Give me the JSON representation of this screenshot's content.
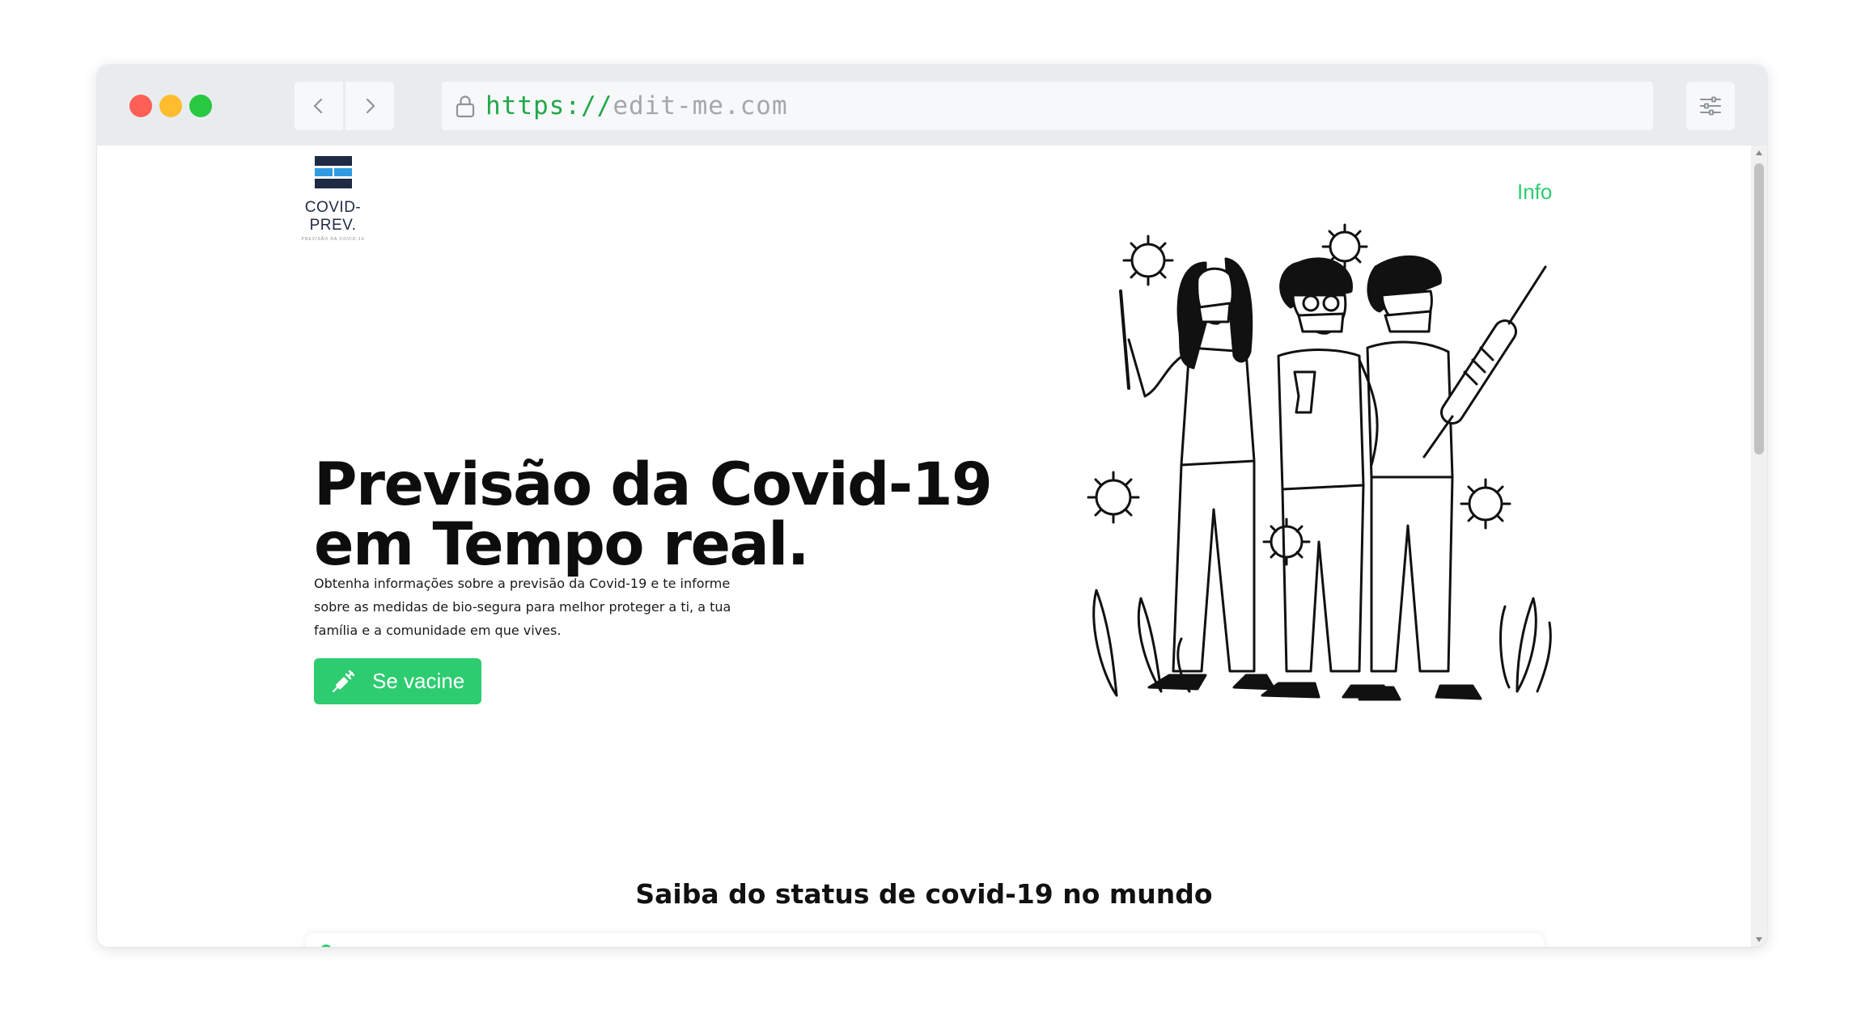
{
  "browser": {
    "url_scheme": "https://",
    "url_host": "edit-me.com",
    "icons": {
      "back": "chevron-left-icon",
      "forward": "chevron-right-icon",
      "lock": "lock-icon",
      "menu": "sliders-icon"
    }
  },
  "site": {
    "logo_text": "COVID-PREV.",
    "logo_tagline": "PREVISÃO DA COVID-19",
    "nav_link": "Info",
    "brand_color": "#2ecc71"
  },
  "hero": {
    "title_line1": "Previsão da Covid-19",
    "title_line2": "em Tempo real.",
    "description": "Obtenha informações sobre a previsão da Covid-19 e te informe sobre as medidas de bio-segura para melhor proteger a ti, a tua família e a comunidade em que vives.",
    "cta_label": "Se vacine",
    "cta_icon": "syringe-icon"
  },
  "status_section": {
    "title": "Saiba do status de covid-19 no mundo"
  }
}
